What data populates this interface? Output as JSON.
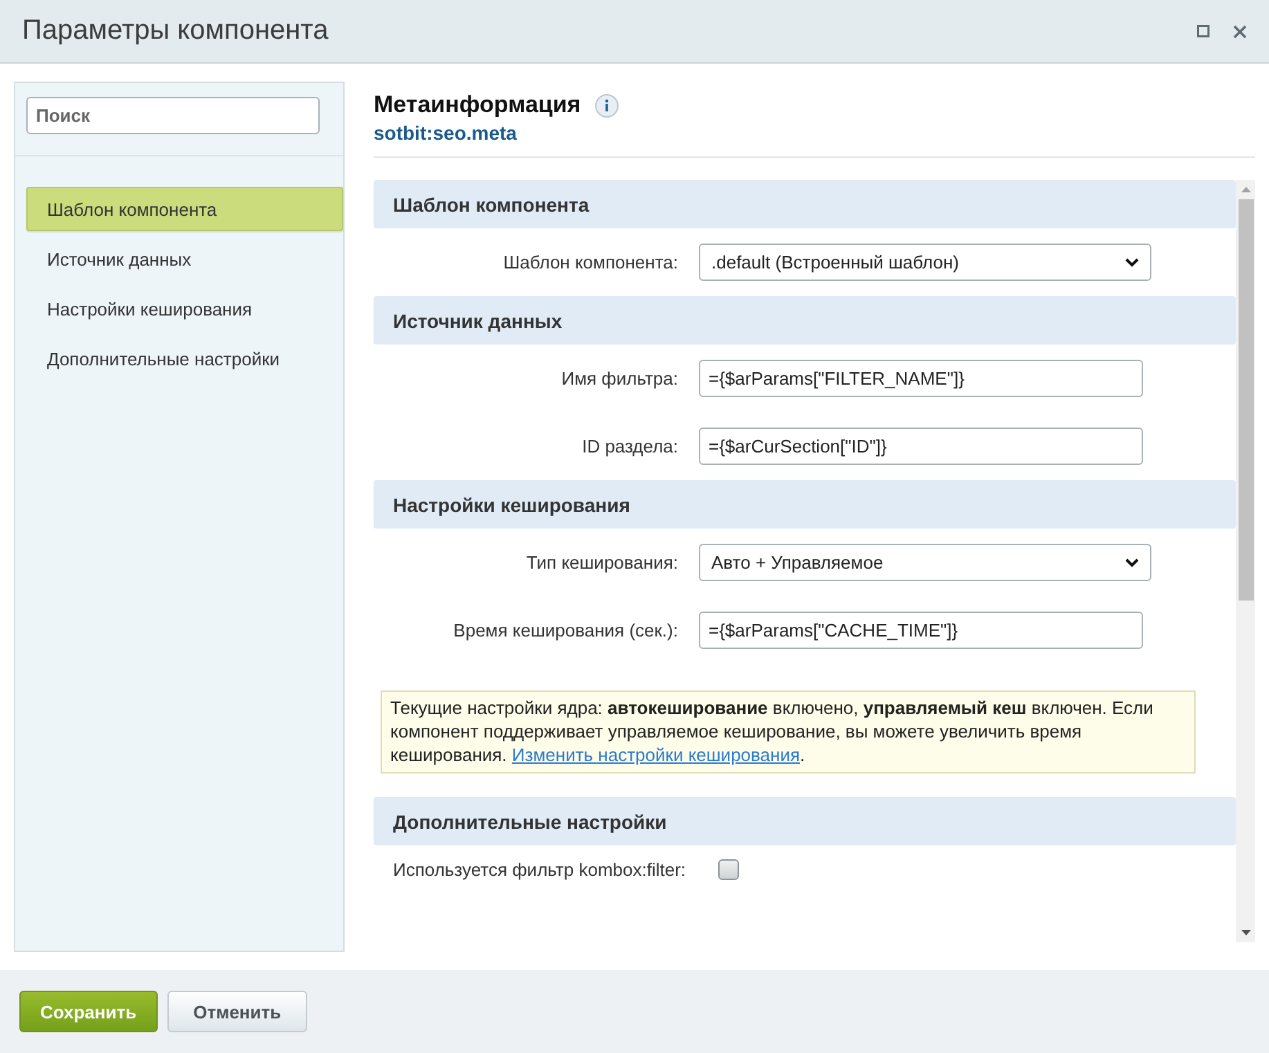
{
  "window": {
    "title": "Параметры компонента"
  },
  "sidebar": {
    "search": {
      "placeholder": "Поиск"
    },
    "items": [
      {
        "label": "Шаблон компонента",
        "selected": true
      },
      {
        "label": "Источник данных",
        "selected": false
      },
      {
        "label": "Настройки кеширования",
        "selected": false
      },
      {
        "label": "Дополнительные настройки",
        "selected": false
      }
    ]
  },
  "header": {
    "title": "Метаинформация",
    "subtitle": "sotbit:seo.meta"
  },
  "sections": [
    {
      "title": "Шаблон компонента",
      "rows": [
        {
          "kind": "select",
          "label": "Шаблон компонента:",
          "value": ".default (Встроенный шаблон)"
        }
      ]
    },
    {
      "title": "Источник данных",
      "rows": [
        {
          "kind": "input",
          "label": "Имя фильтра:",
          "value": "={$arParams[\"FILTER_NAME\"]}"
        },
        {
          "kind": "input",
          "label": "ID раздела:",
          "value": "={$arCurSection[\"ID\"]}"
        }
      ]
    },
    {
      "title": "Настройки кеширования",
      "rows": [
        {
          "kind": "select",
          "label": "Тип кеширования:",
          "value": "Авто + Управляемое"
        },
        {
          "kind": "input",
          "label": "Время кеширования (сек.):",
          "value": "={$arParams[\"CACHE_TIME\"]}"
        },
        {
          "kind": "note",
          "text": "Текущие настройки ядра: **автокеширование** включено, **управляемый кеш** включен. Если компонент поддерживает управляемое кеширование, вы можете увеличить время кеширования.",
          "link": "Изменить настройки кеширования",
          "after": "."
        }
      ]
    },
    {
      "title": "Дополнительные настройки",
      "rows": [
        {
          "kind": "checkbox",
          "label": "Используется фильтр kombox:filter:",
          "checked": false
        }
      ]
    }
  ],
  "footer": {
    "buttons": [
      {
        "label": "Сохранить",
        "kind": "primary"
      },
      {
        "label": "Отменить",
        "kind": "secondary"
      }
    ]
  }
}
